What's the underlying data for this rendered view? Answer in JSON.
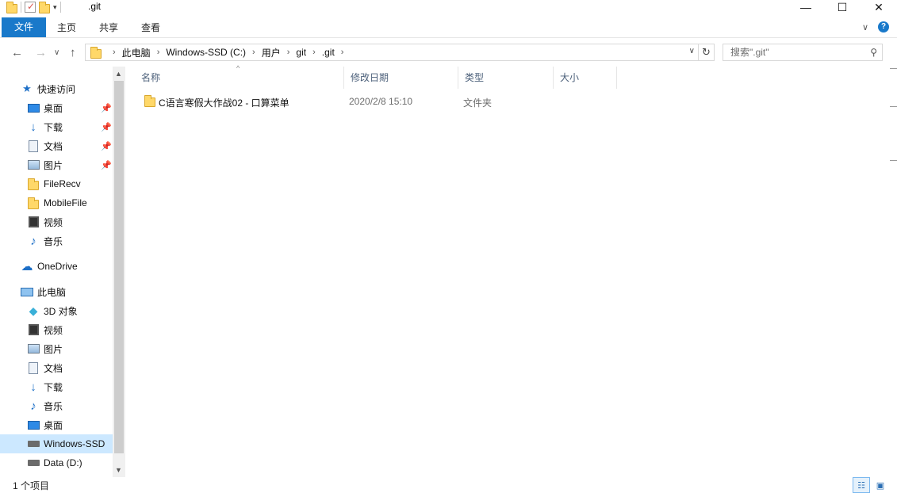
{
  "window": {
    "title": ".git",
    "minimize": "—",
    "maximize": "☐",
    "close": "✕"
  },
  "ribbon": {
    "tabs": [
      {
        "label": "文件"
      },
      {
        "label": "主页"
      },
      {
        "label": "共享"
      },
      {
        "label": "查看"
      }
    ],
    "expand": "∨",
    "help": "?"
  },
  "navigation": {
    "back": "←",
    "forward": "→",
    "recent": "∨",
    "up": "↑",
    "breadcrumb": [
      "此电脑",
      "Windows-SSD (C:)",
      "用户",
      "git",
      ".git"
    ],
    "address_dropdown": "∨",
    "refresh": "↻",
    "search_placeholder": "搜索\".git\""
  },
  "sidebar": {
    "quick_access": "快速访问",
    "quick_items": [
      {
        "label": "桌面",
        "icon": "desktop-icon",
        "pinned": true
      },
      {
        "label": "下载",
        "icon": "download-icon",
        "pinned": true
      },
      {
        "label": "文档",
        "icon": "document-icon",
        "pinned": true
      },
      {
        "label": "图片",
        "icon": "picture-icon",
        "pinned": true
      },
      {
        "label": "FileRecv",
        "icon": "folder-icon",
        "pinned": false
      },
      {
        "label": "MobileFile",
        "icon": "folder-icon",
        "pinned": false
      },
      {
        "label": "视频",
        "icon": "video-icon",
        "pinned": false
      },
      {
        "label": "音乐",
        "icon": "music-icon",
        "pinned": false
      }
    ],
    "onedrive": "OneDrive",
    "this_pc": "此电脑",
    "pc_items": [
      {
        "label": "3D 对象",
        "icon": "3d-objects-icon"
      },
      {
        "label": "视频",
        "icon": "video-icon"
      },
      {
        "label": "图片",
        "icon": "picture-icon"
      },
      {
        "label": "文档",
        "icon": "document-icon"
      },
      {
        "label": "下载",
        "icon": "download-icon"
      },
      {
        "label": "音乐",
        "icon": "music-icon"
      },
      {
        "label": "桌面",
        "icon": "desktop-icon"
      },
      {
        "label": "Windows-SSD",
        "icon": "drive-icon",
        "selected": true
      },
      {
        "label": "Data (D:)",
        "icon": "drive-icon"
      }
    ]
  },
  "columns": {
    "name": "名称",
    "modified": "修改日期",
    "type": "类型",
    "size": "大小"
  },
  "files": [
    {
      "name": "C语言寒假大作战02 - 口算菜单",
      "modified": "2020/2/8 15:10",
      "type": "文件夹",
      "size": ""
    }
  ],
  "status": {
    "count": "1 个项目"
  }
}
